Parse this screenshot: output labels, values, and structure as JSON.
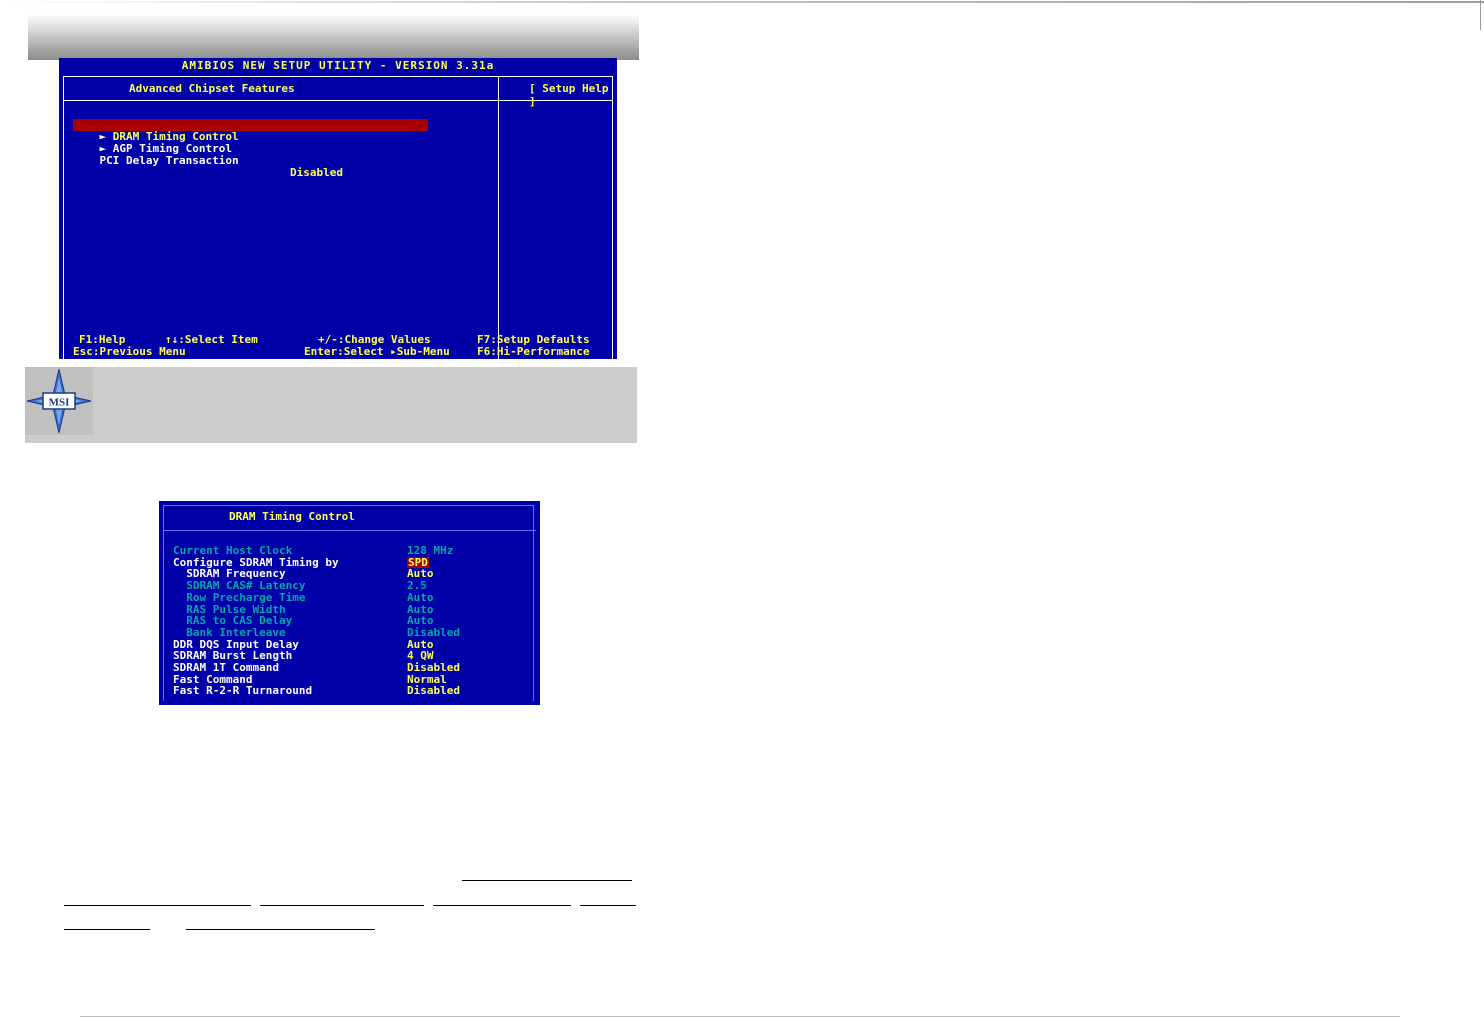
{
  "bios": {
    "title": "AMIBIOS NEW SETUP UTILITY - VERSION 3.31a",
    "heading": "Advanced Chipset Features",
    "help_heading": "[  Setup Help  ]",
    "items": [
      {
        "label": "DRAM Timing Control",
        "submenu": true,
        "selected": true
      },
      {
        "label": "AGP Timing Control",
        "submenu": true,
        "selected": false
      },
      {
        "label": "PCI Delay Transaction",
        "value": "Disabled"
      }
    ],
    "footer": {
      "help": "F1:Help",
      "select_item": "↑↓:Select Item",
      "change_values": "+/-:Change Values",
      "setup_defaults": "F7:Setup Defaults",
      "prev_menu": "Esc:Previous Menu",
      "sub_menu": "Enter:Select ▸Sub-Menu",
      "hi_performance": "F6:Hi-Performance"
    }
  },
  "note": {
    "logo_text": "MSI"
  },
  "dram": {
    "title": "DRAM Timing Control",
    "rows": [
      {
        "label": "Current Host Clock",
        "value": "128 MHz",
        "style": "cyan"
      },
      {
        "label": "Configure SDRAM Timing by",
        "value": "SPD",
        "style": "white-selected"
      },
      {
        "label": "  SDRAM Frequency",
        "value": "Auto",
        "style": "white"
      },
      {
        "label": "  SDRAM CAS# Latency",
        "value": "2.5",
        "style": "cyan"
      },
      {
        "label": "  Row Precharge Time",
        "value": "Auto",
        "style": "cyan"
      },
      {
        "label": "  RAS Pulse Width",
        "value": "Auto",
        "style": "cyan"
      },
      {
        "label": "  RAS to CAS Delay",
        "value": "Auto",
        "style": "cyan"
      },
      {
        "label": "  Bank Interleave",
        "value": "Disabled",
        "style": "cyan"
      },
      {
        "label": "DDR DQS Input Delay",
        "value": "Auto",
        "style": "white"
      },
      {
        "label": "SDRAM Burst Length",
        "value": "4 QW",
        "style": "white"
      },
      {
        "label": "SDRAM 1T Command",
        "value": "Disabled",
        "style": "white"
      },
      {
        "label": "Fast Command",
        "value": "Normal",
        "style": "white"
      },
      {
        "label": "Fast R-2-R Turnaround",
        "value": "Disabled",
        "style": "white"
      }
    ]
  },
  "colors": {
    "bios_bg": "#0000a8",
    "bios_yellow": "#ffff54",
    "bios_cyan": "#00a8a8",
    "selection_red": "#a80000",
    "note_bg": "#cccccc"
  }
}
